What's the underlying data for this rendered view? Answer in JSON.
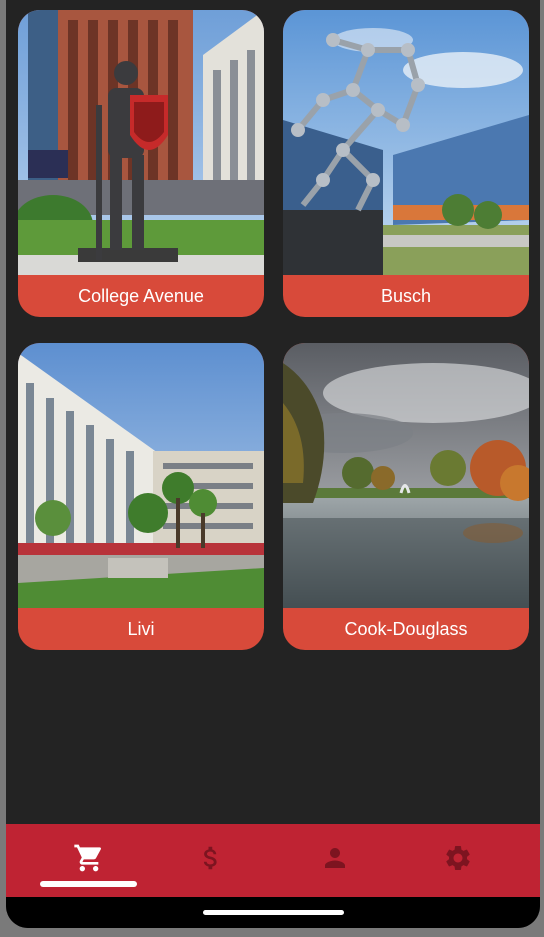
{
  "campuses": [
    {
      "label": "College Avenue"
    },
    {
      "label": "Busch"
    },
    {
      "label": "Livi"
    },
    {
      "label": "Cook-Douglass"
    }
  ],
  "nav": {
    "items": [
      {
        "icon": "cart-icon",
        "active": true
      },
      {
        "icon": "dollar-icon",
        "active": false
      },
      {
        "icon": "person-icon",
        "active": false
      },
      {
        "icon": "gear-icon",
        "active": false
      }
    ]
  },
  "colors": {
    "background": "#232323",
    "card_label_bg": "#d84a3a",
    "nav_bg": "#bf2333",
    "nav_icon_active": "#ffffff",
    "nav_icon_inactive": "#7d1420"
  }
}
